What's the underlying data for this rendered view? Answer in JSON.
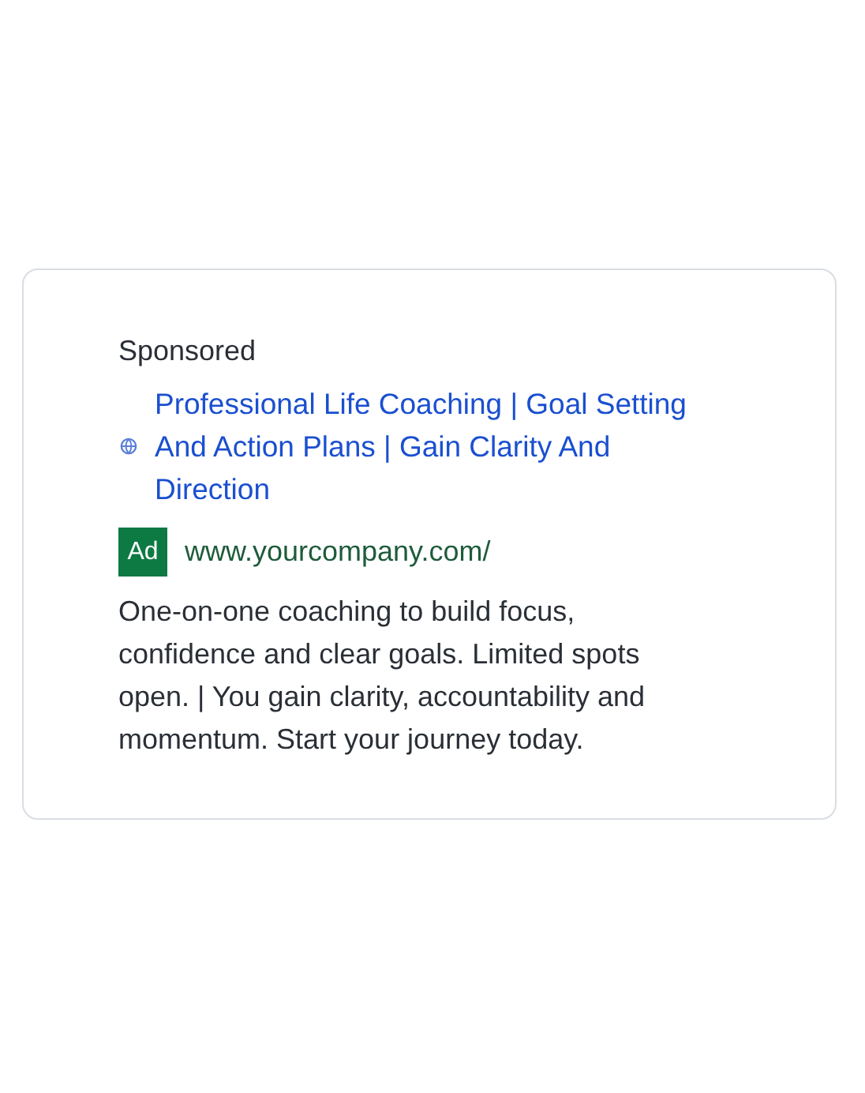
{
  "ad": {
    "label": "Sponsored",
    "title": "Professional Life Coaching | Goal Setting And Action Plans | Gain Clarity And Direction",
    "badge": "Ad",
    "url": "www.yourcompany.com/",
    "description": "One-on-one coaching to build focus, confidence and clear goals. Limited spots open. | You gain clarity, accountability and momentum. Start your journey today."
  }
}
